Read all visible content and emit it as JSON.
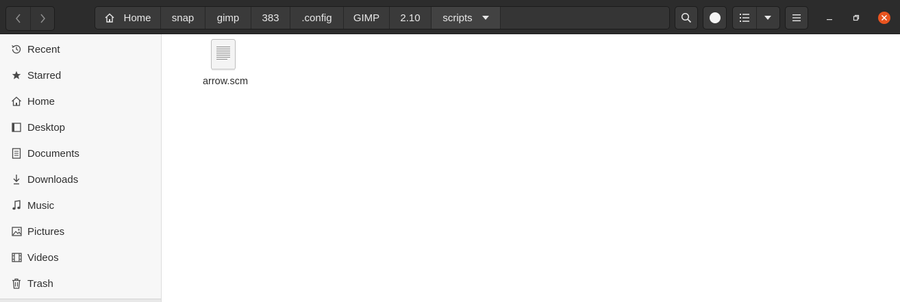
{
  "window": {
    "colors": {
      "header_bg": "#2c2c2c",
      "close_button": "#e9541f",
      "sidebar_bg": "#f7f7f7"
    }
  },
  "toolbar": {
    "back_icon": "chevron-left-icon",
    "forward_icon": "chevron-right-icon",
    "search_icon": "search-icon",
    "status_icon": "circle-icon",
    "list_view_icon": "list-view-icon",
    "view_options_icon": "chevron-down-icon",
    "menu_icon": "hamburger-menu-icon"
  },
  "pathbar": {
    "crumbs": [
      "Home",
      "snap",
      "gimp",
      "383",
      ".config",
      "GIMP",
      "2.10",
      "scripts"
    ]
  },
  "sidebar": {
    "items": [
      {
        "label": "Recent",
        "icon": "clock-icon"
      },
      {
        "label": "Starred",
        "icon": "star-icon"
      },
      {
        "label": "Home",
        "icon": "home-icon"
      },
      {
        "label": "Desktop",
        "icon": "desktop-icon"
      },
      {
        "label": "Documents",
        "icon": "document-icon"
      },
      {
        "label": "Downloads",
        "icon": "download-icon"
      },
      {
        "label": "Music",
        "icon": "music-icon"
      },
      {
        "label": "Pictures",
        "icon": "pictures-icon"
      },
      {
        "label": "Videos",
        "icon": "video-icon"
      },
      {
        "label": "Trash",
        "icon": "trash-icon"
      }
    ]
  },
  "files": [
    {
      "name": "arrow.scm",
      "icon": "text-file-icon"
    }
  ]
}
